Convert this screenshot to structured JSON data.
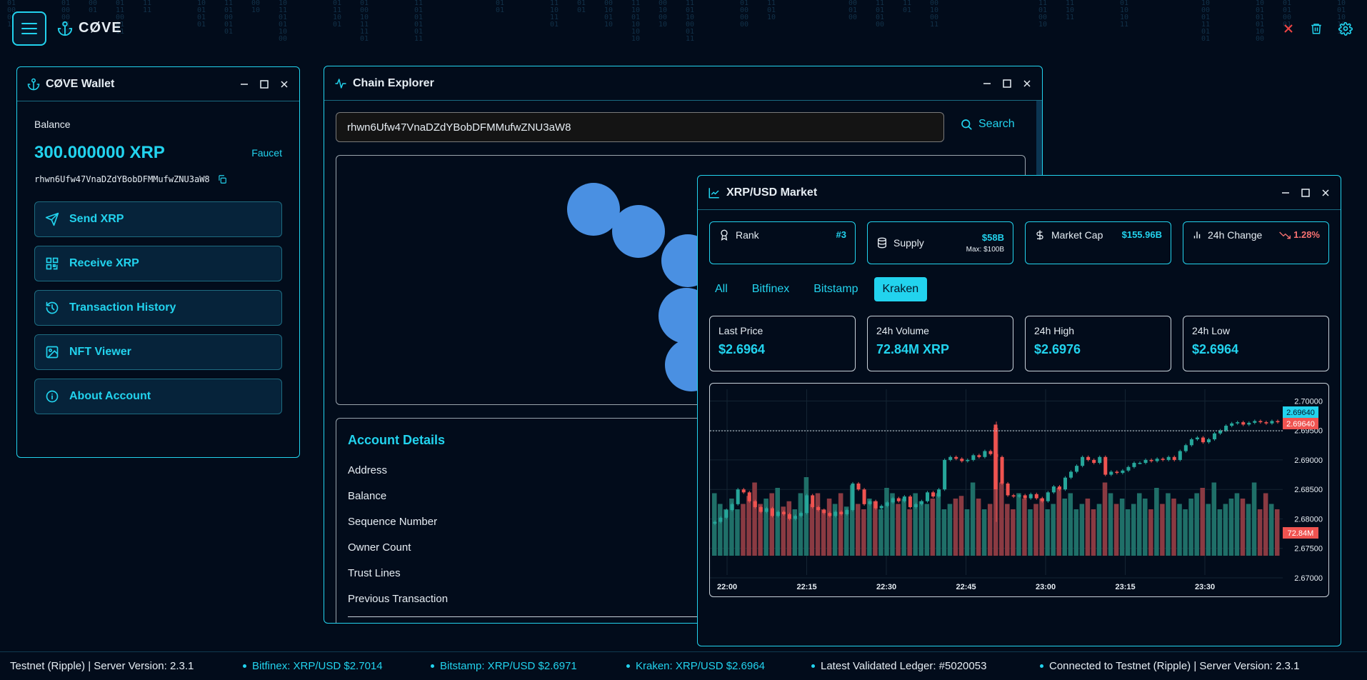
{
  "app": {
    "brand": "CØVE"
  },
  "top_actions": {
    "icons": [
      "close-icon",
      "trash-icon",
      "gear-icon"
    ]
  },
  "wallet": {
    "title": "CØVE Wallet",
    "balance_label": "Balance",
    "balance": "300.000000 XRP",
    "faucet_label": "Faucet",
    "address": "rhwn6Ufw47VnaDZdYBobDFMMufwZNU3aW8",
    "buttons": [
      {
        "label": "Send XRP",
        "icon": "send-icon"
      },
      {
        "label": "Receive XRP",
        "icon": "qr-icon"
      },
      {
        "label": "Transaction History",
        "icon": "history-icon"
      },
      {
        "label": "NFT Viewer",
        "icon": "image-icon"
      },
      {
        "label": "About Account",
        "icon": "info-icon"
      }
    ]
  },
  "explorer": {
    "title": "Chain Explorer",
    "search_value": "rhwn6Ufw47VnaDZdYBobDFMMufwZNU3aW8",
    "search_label": "Search",
    "details_title": "Account Details",
    "details_rows": [
      "Address",
      "Balance",
      "Sequence Number",
      "Owner Count",
      "Trust Lines",
      "Previous Transaction"
    ]
  },
  "market": {
    "title": "XRP/USD Market",
    "stats": {
      "rank_label": "Rank",
      "rank_value": "#3",
      "supply_label": "Supply",
      "supply_value": "$58B",
      "supply_max": "Max: $100B",
      "mcap_label": "Market Cap",
      "mcap_value": "$155.96B",
      "change_label": "24h Change",
      "change_value": "1.28%"
    },
    "exchange_tabs": [
      "All",
      "Bitfinex",
      "Bitstamp",
      "Kraken"
    ],
    "active_tab": "Kraken",
    "price_cards": [
      {
        "label": "Last Price",
        "value": "$2.6964"
      },
      {
        "label": "24h Volume",
        "value": "72.84M XRP"
      },
      {
        "label": "24h High",
        "value": "$2.6976"
      },
      {
        "label": "24h Low",
        "value": "$2.6964"
      }
    ],
    "colors": {
      "up": "#26a69a",
      "down": "#ef5350",
      "accent": "#22d3ee"
    }
  },
  "chart_data": {
    "type": "candlestick",
    "x_ticks": [
      "22:00",
      "22:15",
      "22:30",
      "22:45",
      "23:00",
      "23:15",
      "23:30"
    ],
    "y_ticks": [
      "2.70000",
      "2.69500",
      "2.69000",
      "2.68500",
      "2.68000",
      "2.67500",
      "2.67000"
    ],
    "ylim": [
      2.67,
      2.7015
    ],
    "last_price_label": "2.69640",
    "current_price_label": "2.69640",
    "volume_label": "72.84M",
    "last_price": 2.6964,
    "close": [
      2.6795,
      2.6802,
      2.6815,
      2.6825,
      2.685,
      2.6845,
      2.683,
      2.682,
      2.6812,
      2.6818,
      2.6805,
      2.6812,
      2.6808,
      2.68,
      2.6805,
      2.681,
      2.684,
      2.682,
      2.6815,
      2.681,
      2.6805,
      2.6812,
      2.6808,
      2.6815,
      2.686,
      2.685,
      2.6825,
      2.683,
      2.6818,
      2.6822,
      2.6828,
      2.6835,
      2.683,
      2.6838,
      2.682,
      2.6825,
      2.683,
      2.6845,
      2.6838,
      2.685,
      2.69,
      2.6905,
      2.6902,
      2.6898,
      2.69,
      2.6908,
      2.6905,
      2.6915,
      2.691,
      2.6905,
      2.686,
      2.684,
      2.6838,
      2.684,
      2.6835,
      2.6842,
      2.6835,
      2.683,
      2.6845,
      2.6855,
      2.685,
      2.687,
      2.688,
      2.689,
      2.6905,
      2.69,
      2.6895,
      2.6905,
      2.6875,
      2.688,
      2.6878,
      2.6882,
      2.6888,
      2.6895,
      2.6895,
      2.69,
      2.6898,
      2.6902,
      2.69,
      2.6905,
      2.69,
      2.6915,
      2.6925,
      2.6935,
      2.6938,
      2.693,
      2.6935,
      2.6945,
      2.695,
      2.6958,
      2.6962,
      2.6964,
      2.696,
      2.6963,
      2.6966,
      2.6964,
      2.6962,
      2.6966,
      2.6964
    ],
    "volume": [
      18,
      14,
      12,
      16,
      12,
      14,
      17,
      22,
      14,
      16,
      18,
      20,
      13,
      15,
      12,
      18,
      24,
      14,
      18,
      12,
      16,
      14,
      18,
      13,
      21,
      14,
      12,
      16,
      15,
      12,
      20,
      18,
      14,
      16,
      12,
      18,
      15,
      14,
      16,
      18,
      12,
      14,
      16,
      17,
      12,
      22,
      16,
      12,
      14,
      16,
      22,
      14,
      12,
      18,
      16,
      12,
      14,
      16,
      12,
      14,
      20,
      16,
      18,
      12,
      14,
      16,
      12,
      14,
      22,
      18,
      14,
      16,
      12,
      14,
      18,
      16,
      12,
      20,
      14,
      18,
      16,
      14,
      12,
      16,
      18,
      20,
      14,
      22,
      12,
      14,
      16,
      18,
      16,
      14,
      22,
      12,
      18,
      14,
      12
    ],
    "spike_index": 49
  },
  "status_bar": {
    "network": "Testnet (Ripple) | Server Version: 2.3.1",
    "items": [
      "Bitfinex: XRP/USD $2.7014",
      "Bitstamp: XRP/USD $2.6971",
      "Kraken: XRP/USD $2.6964",
      "Latest Validated Ledger: #5020053",
      "Connected to Testnet (Ripple) | Server Version: 2.3.1"
    ]
  }
}
